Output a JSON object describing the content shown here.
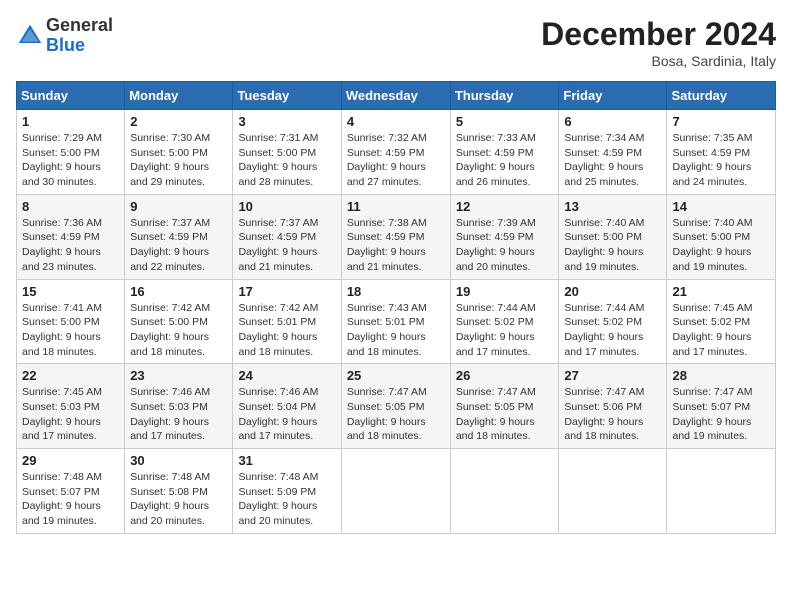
{
  "header": {
    "logo_general": "General",
    "logo_blue": "Blue",
    "title": "December 2024",
    "location": "Bosa, Sardinia, Italy"
  },
  "days_of_week": [
    "Sunday",
    "Monday",
    "Tuesday",
    "Wednesday",
    "Thursday",
    "Friday",
    "Saturday"
  ],
  "weeks": [
    [
      {
        "day": "1",
        "sunrise": "Sunrise: 7:29 AM",
        "sunset": "Sunset: 5:00 PM",
        "daylight": "Daylight: 9 hours and 30 minutes."
      },
      {
        "day": "2",
        "sunrise": "Sunrise: 7:30 AM",
        "sunset": "Sunset: 5:00 PM",
        "daylight": "Daylight: 9 hours and 29 minutes."
      },
      {
        "day": "3",
        "sunrise": "Sunrise: 7:31 AM",
        "sunset": "Sunset: 5:00 PM",
        "daylight": "Daylight: 9 hours and 28 minutes."
      },
      {
        "day": "4",
        "sunrise": "Sunrise: 7:32 AM",
        "sunset": "Sunset: 4:59 PM",
        "daylight": "Daylight: 9 hours and 27 minutes."
      },
      {
        "day": "5",
        "sunrise": "Sunrise: 7:33 AM",
        "sunset": "Sunset: 4:59 PM",
        "daylight": "Daylight: 9 hours and 26 minutes."
      },
      {
        "day": "6",
        "sunrise": "Sunrise: 7:34 AM",
        "sunset": "Sunset: 4:59 PM",
        "daylight": "Daylight: 9 hours and 25 minutes."
      },
      {
        "day": "7",
        "sunrise": "Sunrise: 7:35 AM",
        "sunset": "Sunset: 4:59 PM",
        "daylight": "Daylight: 9 hours and 24 minutes."
      }
    ],
    [
      {
        "day": "8",
        "sunrise": "Sunrise: 7:36 AM",
        "sunset": "Sunset: 4:59 PM",
        "daylight": "Daylight: 9 hours and 23 minutes."
      },
      {
        "day": "9",
        "sunrise": "Sunrise: 7:37 AM",
        "sunset": "Sunset: 4:59 PM",
        "daylight": "Daylight: 9 hours and 22 minutes."
      },
      {
        "day": "10",
        "sunrise": "Sunrise: 7:37 AM",
        "sunset": "Sunset: 4:59 PM",
        "daylight": "Daylight: 9 hours and 21 minutes."
      },
      {
        "day": "11",
        "sunrise": "Sunrise: 7:38 AM",
        "sunset": "Sunset: 4:59 PM",
        "daylight": "Daylight: 9 hours and 21 minutes."
      },
      {
        "day": "12",
        "sunrise": "Sunrise: 7:39 AM",
        "sunset": "Sunset: 4:59 PM",
        "daylight": "Daylight: 9 hours and 20 minutes."
      },
      {
        "day": "13",
        "sunrise": "Sunrise: 7:40 AM",
        "sunset": "Sunset: 5:00 PM",
        "daylight": "Daylight: 9 hours and 19 minutes."
      },
      {
        "day": "14",
        "sunrise": "Sunrise: 7:40 AM",
        "sunset": "Sunset: 5:00 PM",
        "daylight": "Daylight: 9 hours and 19 minutes."
      }
    ],
    [
      {
        "day": "15",
        "sunrise": "Sunrise: 7:41 AM",
        "sunset": "Sunset: 5:00 PM",
        "daylight": "Daylight: 9 hours and 18 minutes."
      },
      {
        "day": "16",
        "sunrise": "Sunrise: 7:42 AM",
        "sunset": "Sunset: 5:00 PM",
        "daylight": "Daylight: 9 hours and 18 minutes."
      },
      {
        "day": "17",
        "sunrise": "Sunrise: 7:42 AM",
        "sunset": "Sunset: 5:01 PM",
        "daylight": "Daylight: 9 hours and 18 minutes."
      },
      {
        "day": "18",
        "sunrise": "Sunrise: 7:43 AM",
        "sunset": "Sunset: 5:01 PM",
        "daylight": "Daylight: 9 hours and 18 minutes."
      },
      {
        "day": "19",
        "sunrise": "Sunrise: 7:44 AM",
        "sunset": "Sunset: 5:02 PM",
        "daylight": "Daylight: 9 hours and 17 minutes."
      },
      {
        "day": "20",
        "sunrise": "Sunrise: 7:44 AM",
        "sunset": "Sunset: 5:02 PM",
        "daylight": "Daylight: 9 hours and 17 minutes."
      },
      {
        "day": "21",
        "sunrise": "Sunrise: 7:45 AM",
        "sunset": "Sunset: 5:02 PM",
        "daylight": "Daylight: 9 hours and 17 minutes."
      }
    ],
    [
      {
        "day": "22",
        "sunrise": "Sunrise: 7:45 AM",
        "sunset": "Sunset: 5:03 PM",
        "daylight": "Daylight: 9 hours and 17 minutes."
      },
      {
        "day": "23",
        "sunrise": "Sunrise: 7:46 AM",
        "sunset": "Sunset: 5:03 PM",
        "daylight": "Daylight: 9 hours and 17 minutes."
      },
      {
        "day": "24",
        "sunrise": "Sunrise: 7:46 AM",
        "sunset": "Sunset: 5:04 PM",
        "daylight": "Daylight: 9 hours and 17 minutes."
      },
      {
        "day": "25",
        "sunrise": "Sunrise: 7:47 AM",
        "sunset": "Sunset: 5:05 PM",
        "daylight": "Daylight: 9 hours and 18 minutes."
      },
      {
        "day": "26",
        "sunrise": "Sunrise: 7:47 AM",
        "sunset": "Sunset: 5:05 PM",
        "daylight": "Daylight: 9 hours and 18 minutes."
      },
      {
        "day": "27",
        "sunrise": "Sunrise: 7:47 AM",
        "sunset": "Sunset: 5:06 PM",
        "daylight": "Daylight: 9 hours and 18 minutes."
      },
      {
        "day": "28",
        "sunrise": "Sunrise: 7:47 AM",
        "sunset": "Sunset: 5:07 PM",
        "daylight": "Daylight: 9 hours and 19 minutes."
      }
    ],
    [
      {
        "day": "29",
        "sunrise": "Sunrise: 7:48 AM",
        "sunset": "Sunset: 5:07 PM",
        "daylight": "Daylight: 9 hours and 19 minutes."
      },
      {
        "day": "30",
        "sunrise": "Sunrise: 7:48 AM",
        "sunset": "Sunset: 5:08 PM",
        "daylight": "Daylight: 9 hours and 20 minutes."
      },
      {
        "day": "31",
        "sunrise": "Sunrise: 7:48 AM",
        "sunset": "Sunset: 5:09 PM",
        "daylight": "Daylight: 9 hours and 20 minutes."
      },
      null,
      null,
      null,
      null
    ]
  ]
}
